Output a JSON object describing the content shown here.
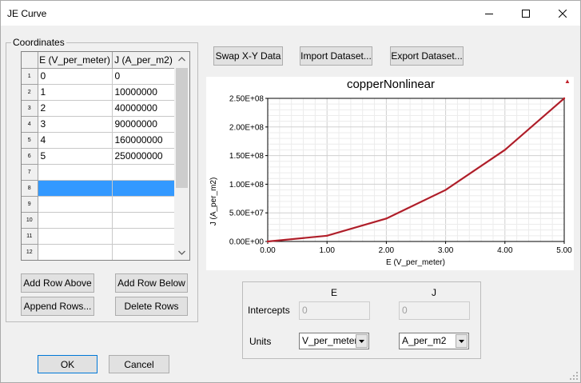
{
  "window": {
    "title": "JE Curve"
  },
  "coordinates": {
    "group_label": "Coordinates",
    "columns": [
      "E (V_per_meter)",
      "J (A_per_m2)"
    ],
    "row_numbers": [
      "1",
      "2",
      "3",
      "4",
      "5",
      "6",
      "7",
      "8",
      "9",
      "10",
      "11",
      "12"
    ],
    "rows": [
      [
        "0",
        "0"
      ],
      [
        "1",
        "10000000"
      ],
      [
        "2",
        "40000000"
      ],
      [
        "3",
        "90000000"
      ],
      [
        "4",
        "160000000"
      ],
      [
        "5",
        "250000000"
      ],
      [
        "",
        ""
      ],
      [
        "",
        ""
      ],
      [
        "",
        ""
      ],
      [
        "",
        ""
      ],
      [
        "",
        ""
      ],
      [
        "",
        ""
      ]
    ],
    "selected_row": 8
  },
  "buttons": {
    "add_row_above": "Add Row Above",
    "add_row_below": "Add Row Below",
    "append_rows": "Append Rows...",
    "delete_rows": "Delete Rows",
    "swap_xy": "Swap X-Y Data",
    "import_dataset": "Import Dataset...",
    "export_dataset": "Export Dataset...",
    "ok": "OK",
    "cancel": "Cancel"
  },
  "axes_panel": {
    "col_e": "E",
    "col_j": "J",
    "intercepts_label": "Intercepts",
    "units_label": "Units",
    "intercept_e": "0",
    "intercept_j": "0",
    "units_e": "V_per_meter",
    "units_j": "A_per_m2"
  },
  "chart_data": {
    "type": "line",
    "title": "copperNonlinear",
    "xlabel": "E (V_per_meter)",
    "ylabel": "J (A_per_m2)",
    "xlim": [
      0,
      5
    ],
    "ylim": [
      0,
      250000000
    ],
    "x_ticks": [
      "0.00",
      "1.00",
      "2.00",
      "3.00",
      "4.00",
      "5.00"
    ],
    "y_ticks": [
      "0.00E+00",
      "5.00E+07",
      "1.00E+08",
      "1.50E+08",
      "2.00E+08",
      "2.50E+08"
    ],
    "grid": true,
    "series": [
      {
        "x": [
          0,
          1,
          2,
          3,
          4,
          5
        ],
        "y": [
          0,
          10000000,
          40000000,
          90000000,
          160000000,
          250000000
        ],
        "color": "#c0202a"
      }
    ]
  }
}
